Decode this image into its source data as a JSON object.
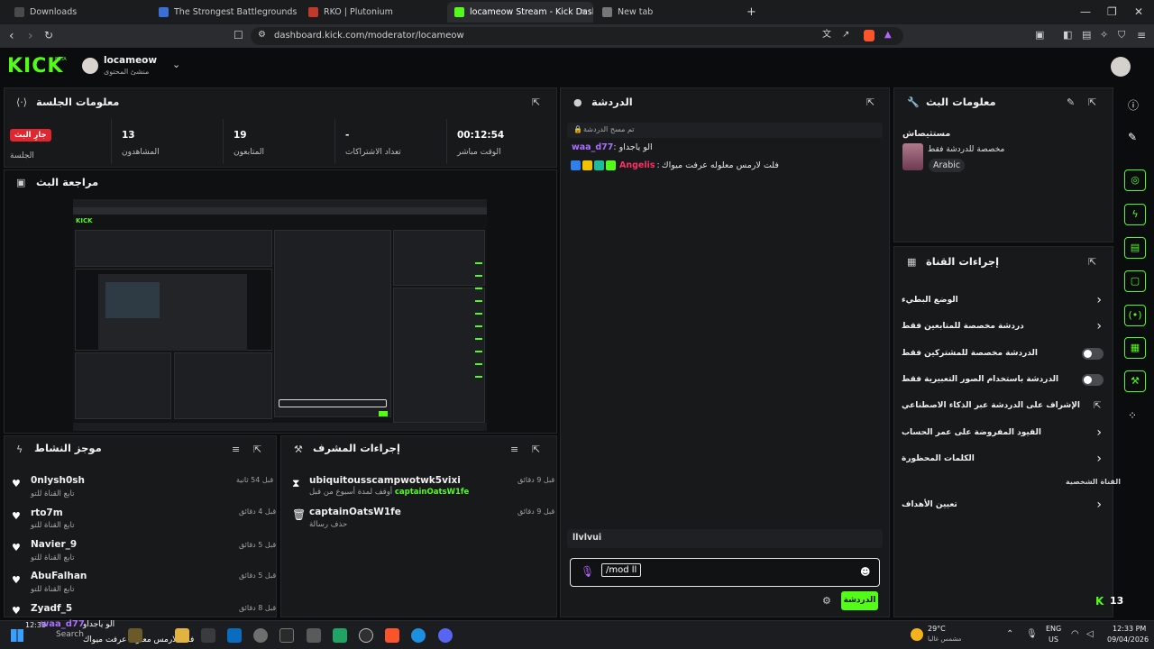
{
  "browser": {
    "tabs": [
      {
        "title": "Downloads",
        "color": "#4a4a4a"
      },
      {
        "title": "The Strongest Battlegrounds | Play o",
        "color": "#3b6fd8"
      },
      {
        "title": "RKO | Plutonium",
        "color": "#c0392b"
      },
      {
        "title": "locameow Stream - Kick Dashbo",
        "color": "#53fc18"
      },
      {
        "title": "New tab",
        "color": "#777777"
      }
    ],
    "url": "dashboard.kick.com/moderator/locameow",
    "tab_close": "×",
    "new_tab": "+",
    "window_controls": [
      "—",
      "❐",
      "✕"
    ]
  },
  "header": {
    "logo": "KICK",
    "beta": "BETA",
    "channel_name": "locameow",
    "channel_role": "منشئ المحتوى"
  },
  "session": {
    "title": "معلومات الجلسة",
    "live_badge": "جارِ البث",
    "live_label": "الجلسة",
    "stats": [
      {
        "value": "13",
        "label": "المشاهدون"
      },
      {
        "value": "19",
        "label": "المتابعون"
      },
      {
        "value": "-",
        "label": "تعداد الاشتراكات"
      },
      {
        "value": "00:12:54",
        "label": "الوقت مباشر"
      }
    ]
  },
  "preview": {
    "title": "مراجعة البث"
  },
  "chat": {
    "title": "الدردشة",
    "pinned": "تم مسح الدردشة",
    "messages": [
      {
        "user": "waa_d77",
        "user_color": "#a970ff",
        "text": "الو ياجداو"
      },
      {
        "user": "Angelis",
        "user_color": "#ff2e63",
        "text": "فلت لارمس معلوله عرفت ميواك"
      }
    ],
    "typing_user": "llvlvui",
    "input_value": "/mod ll",
    "send_label": "الدردشة"
  },
  "stream_info": {
    "title": "معلومات البث",
    "stream_title": "مستثيصاش",
    "category": "مخصصة للدردشة فقط",
    "language": "Arabic"
  },
  "channel_actions": {
    "title": "إجراءات القناة",
    "items": [
      {
        "label": "الوضع البطيء",
        "control": "chevron"
      },
      {
        "label": "دردشة مخصصة للمتابعين فقط",
        "control": "chevron"
      },
      {
        "label": "الدردشة مخصصة للمشتركين فقط",
        "control": "toggle"
      },
      {
        "label": "الدردشة باستخدام الصور التعبيرية فقط",
        "control": "toggle"
      },
      {
        "label": "الإشراف على الدردشة عبر الذكاء الاصطناعي",
        "control": "external"
      },
      {
        "label": "القيود المفروضة على عمر الحساب",
        "control": "chevron"
      },
      {
        "label": "الكلمات المحظورة",
        "control": "chevron"
      }
    ],
    "section_label": "القناة الشخصية",
    "last_item": "تعيين الأهداف",
    "viewer_count": "13"
  },
  "activity": {
    "title": "موجز النشاط",
    "events": [
      {
        "user": "0nlysh0sh",
        "sub": "تابع القناة للتو",
        "time": "قبل 54 ثانية"
      },
      {
        "user": "rto7m",
        "sub": "تابع القناة للتو",
        "time": "قبل 4 دقائق"
      },
      {
        "user": "Navier_9",
        "sub": "تابع القناة للتو",
        "time": "قبل 5 دقائق"
      },
      {
        "user": "AbuFalhan",
        "sub": "تابع القناة للتو",
        "time": "قبل 5 دقائق"
      },
      {
        "user": "Zyadf_5",
        "sub": "",
        "time": "قبل 8 دقائق"
      }
    ]
  },
  "mod_actions": {
    "title": "إجراءات المشرف",
    "entries": [
      {
        "user": "ubiquitousscampwotwk5vixi",
        "sub_prefix": "أوقف لمدة أسبوع من قبل",
        "sub_user": "captainOatsW1fe",
        "time": "قبل 9 دقائق"
      },
      {
        "user": "captainOatsW1fe",
        "sub_prefix": "حذف رسالة",
        "sub_user": "",
        "time": "قبل 9 دقائق"
      }
    ]
  },
  "taskbar": {
    "overlay_user": "waa_d77",
    "overlay_text1": "الو ياجداو",
    "overlay_text2": "فلت لارمس معلوله عرفت ميواك",
    "overlay_time": "12:33",
    "search": "Search",
    "weather_temp": "29°C",
    "weather_desc": "مشمس غالبا",
    "lang": "ENG",
    "region": "US",
    "clock": "12:33 PM",
    "date": "09/04/2026"
  }
}
